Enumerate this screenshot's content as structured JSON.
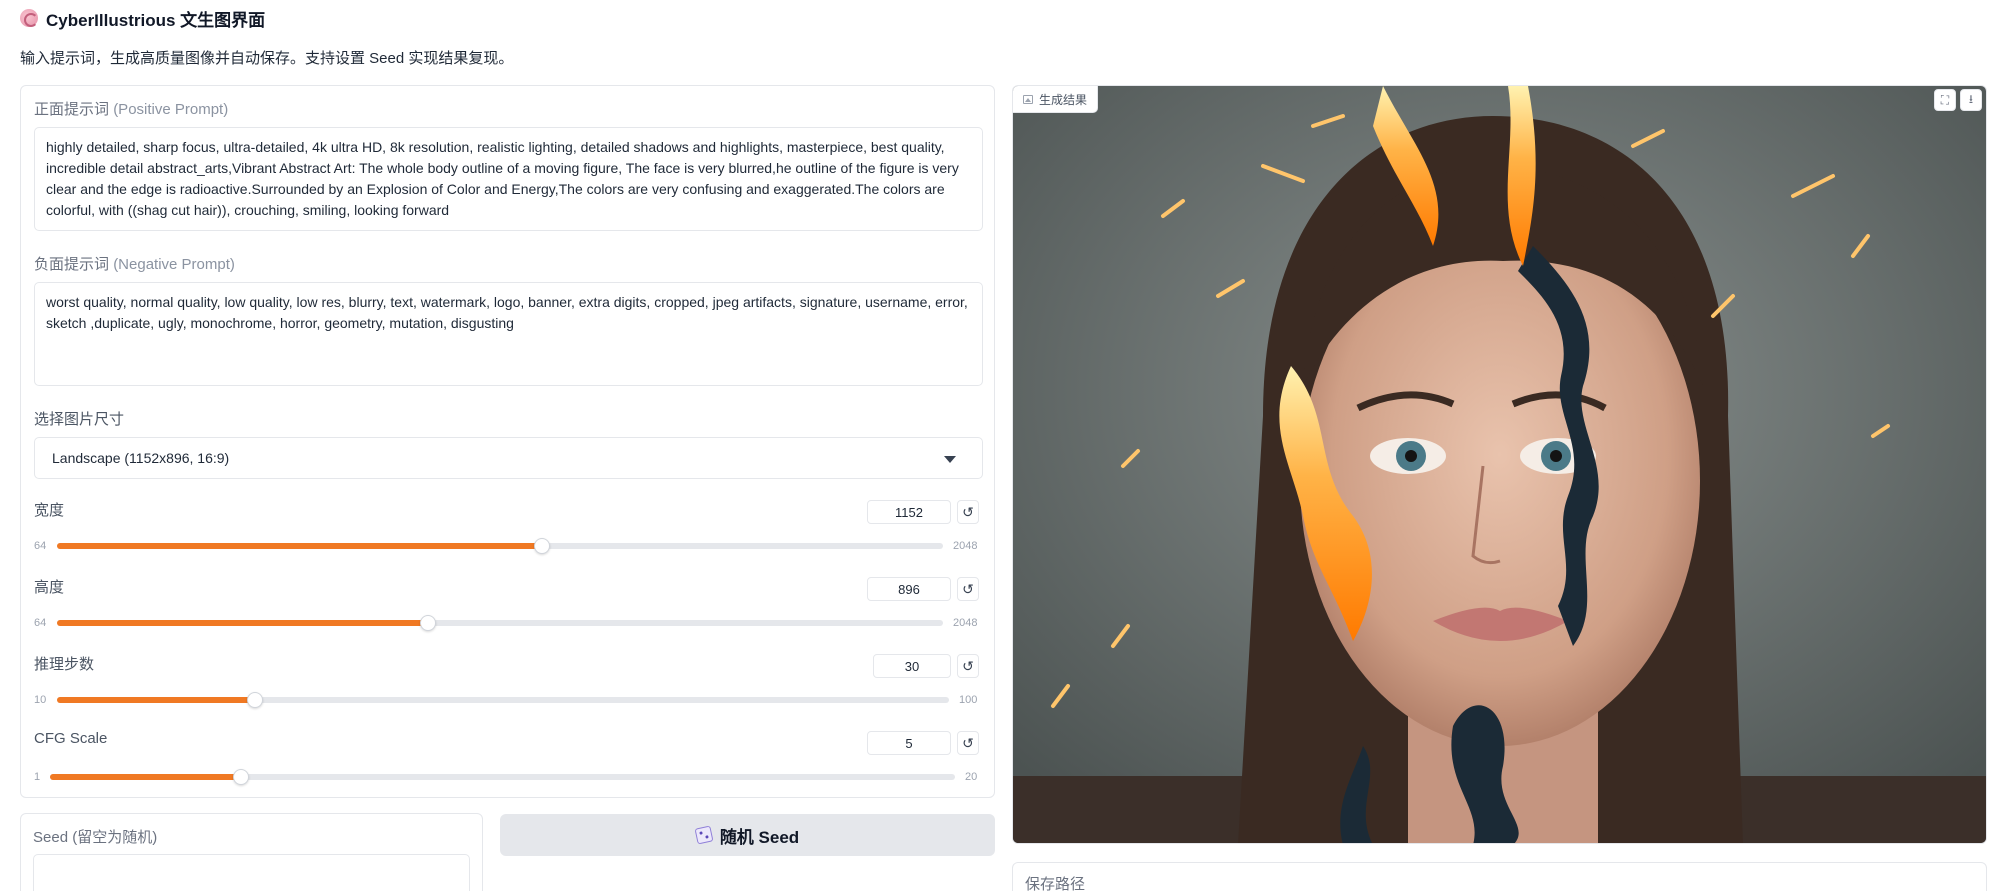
{
  "header": {
    "title": "CyberIllustrious 文生图界面",
    "subtitle": "输入提示词，生成高质量图像并自动保存。支持设置 Seed 实现结果复现。"
  },
  "positive_prompt": {
    "label": "正面提示词",
    "label_en": "(Positive Prompt)",
    "value": "highly detailed, sharp focus, ultra-detailed, 4k ultra HD, 8k resolution, realistic lighting, detailed shadows and highlights, masterpiece, best quality, incredible detail abstract_arts,Vibrant Abstract Art: The whole body outline of a moving figure, The face is very blurred,he outline of the figure is very clear and the edge is radioactive.Surrounded by an Explosion of Color and Energy,The colors are very confusing and exaggerated.The colors are colorful, with ((shag cut hair)), crouching, smiling, looking forward"
  },
  "negative_prompt": {
    "label": "负面提示词",
    "label_en": "(Negative Prompt)",
    "value": "worst quality, normal quality, low quality, low res, blurry, text, watermark, logo, banner, extra digits, cropped, jpeg artifacts, signature, username, error, sketch ,duplicate, ugly, monochrome, horror, geometry, mutation, disgusting"
  },
  "size_select": {
    "label": "选择图片尺寸",
    "value": "Landscape (1152x896, 16:9)"
  },
  "sliders": {
    "width": {
      "label": "宽度",
      "value": "1152",
      "min": "64",
      "max": "2048",
      "fraction": 0.547
    },
    "height": {
      "label": "高度",
      "value": "896",
      "min": "64",
      "max": "2048",
      "fraction": 0.419
    },
    "steps": {
      "label": "推理步数",
      "value": "30",
      "min": "10",
      "max": "100",
      "fraction": 0.222
    },
    "cfg": {
      "label": "CFG Scale",
      "value": "5",
      "min": "1",
      "max": "20",
      "fraction": 0.211
    }
  },
  "reset_icon": "↺",
  "seed": {
    "label": "Seed (留空为随机)",
    "value": ""
  },
  "random_button": {
    "label": "随机 Seed",
    "icon": "dice-icon"
  },
  "result": {
    "label": "生成结果"
  },
  "save_path": {
    "label": "保存路径"
  },
  "colors": {
    "accent": "#f07923",
    "button_bg": "#e5e7eb"
  }
}
